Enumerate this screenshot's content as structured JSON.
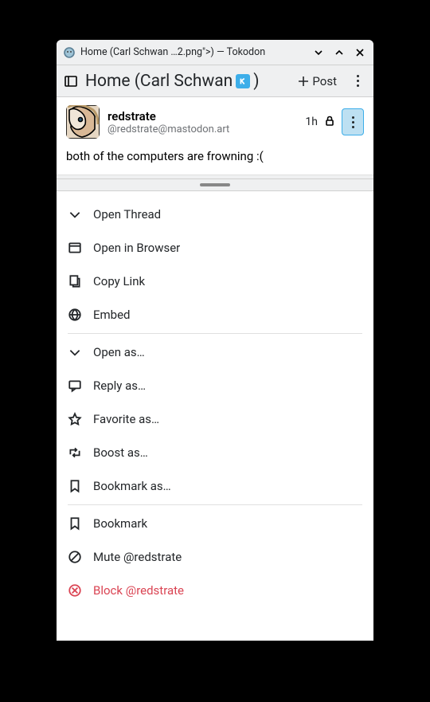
{
  "window": {
    "title": "Home (Carl Schwan …2.png\">) — Tokodon"
  },
  "toolbar": {
    "page_title": "Home (Carl Schwan ",
    "page_title_suffix": ")",
    "post_label": "Post"
  },
  "post": {
    "display_name": "redstrate",
    "handle": "@redstrate@mastodon.art",
    "timestamp": "1h",
    "body": "both of the computers are frowning :("
  },
  "menu": {
    "open_thread": "Open Thread",
    "open_browser": "Open in Browser",
    "copy_link": "Copy Link",
    "embed": "Embed",
    "open_as": "Open as…",
    "reply_as": "Reply as…",
    "favorite_as": "Favorite as…",
    "boost_as": "Boost as…",
    "bookmark_as": "Bookmark as…",
    "bookmark": "Bookmark",
    "mute": "Mute @redstrate",
    "block": "Block @redstrate"
  }
}
